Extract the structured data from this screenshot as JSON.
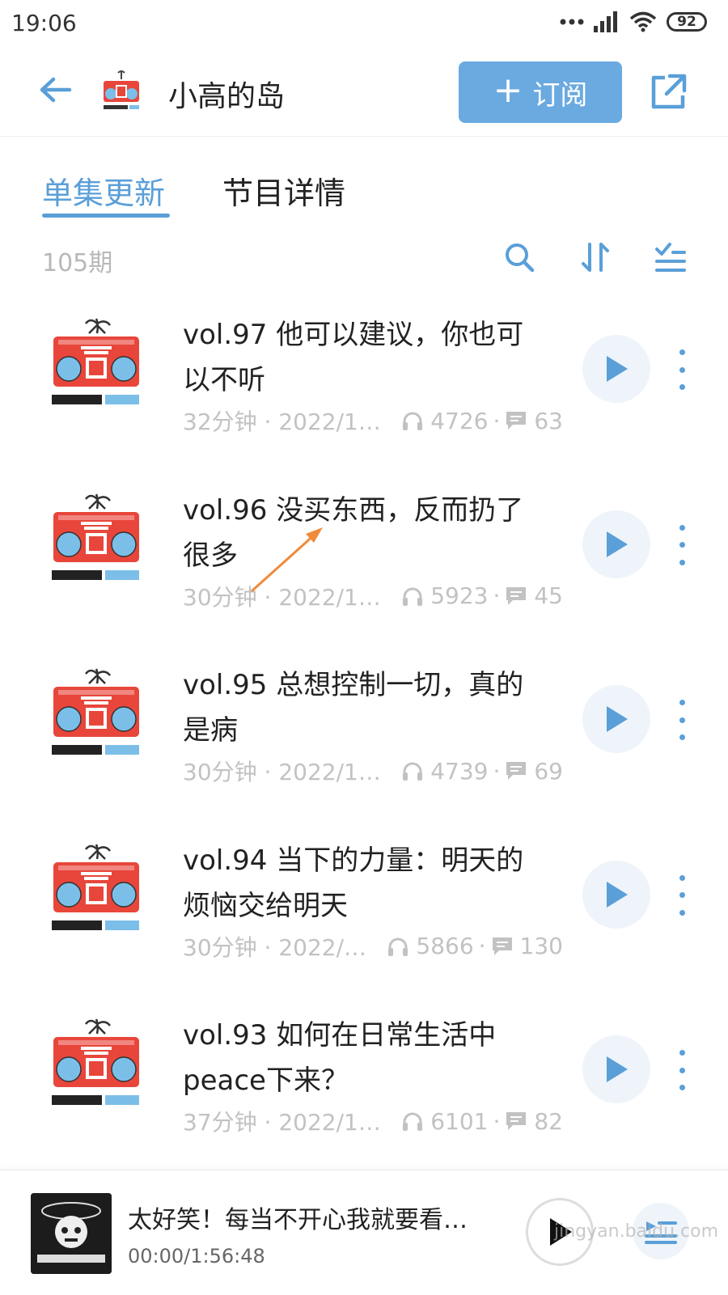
{
  "status_bar": {
    "time": "19:06",
    "battery": "92"
  },
  "header": {
    "title": "小高的岛",
    "subscribe_label": "订阅",
    "accent_color": "#6aaae0"
  },
  "tabs": [
    {
      "label": "单集更新",
      "active": true
    },
    {
      "label": "节目详情",
      "active": false
    }
  ],
  "list_toolbar": {
    "count": "105期"
  },
  "episodes": [
    {
      "title": "vol.97 他可以建议，你也可以不听",
      "duration_date": "32分钟 · 2022/1…",
      "plays": "4726",
      "comments": "63"
    },
    {
      "title": "vol.96 没买东西，反而扔了很多",
      "duration_date": "30分钟 · 2022/1…",
      "plays": "5923",
      "comments": "45"
    },
    {
      "title": "vol.95 总想控制一切，真的是病",
      "duration_date": "30分钟 · 2022/1…",
      "plays": "4739",
      "comments": "69"
    },
    {
      "title": "vol.94 当下的力量：明天的烦恼交给明天",
      "duration_date": "30分钟 · 2022/…",
      "plays": "5866",
      "comments": "130"
    },
    {
      "title": "vol.93 如何在日常生活中peace下来？",
      "duration_date": "37分钟 · 2022/1…",
      "plays": "6101",
      "comments": "82"
    }
  ],
  "player": {
    "title": "太好笑！每当不开心我就要看…",
    "time": "00:00/1:56:48"
  },
  "watermark": "jingyan.baidu.com"
}
